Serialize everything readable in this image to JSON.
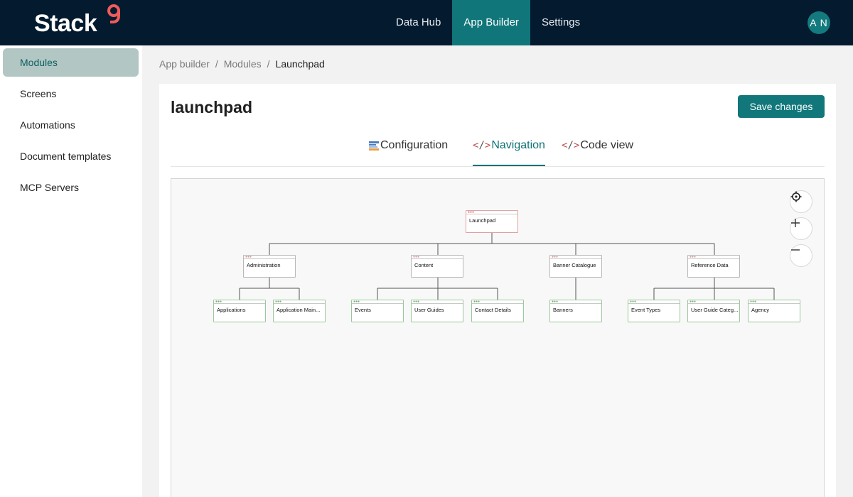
{
  "app": {
    "logo_text": "Stack",
    "logo_mark": "9",
    "avatar_initials": "A N"
  },
  "topnav": [
    {
      "label": "Data Hub"
    },
    {
      "label": "App Builder"
    },
    {
      "label": "Settings"
    }
  ],
  "sidebar": {
    "items": [
      {
        "label": "Modules"
      },
      {
        "label": "Screens"
      },
      {
        "label": "Automations"
      },
      {
        "label": "Document templates"
      },
      {
        "label": "MCP Servers"
      }
    ]
  },
  "breadcrumb": {
    "items": [
      "App builder",
      "Modules",
      "Launchpad"
    ],
    "separator": "/"
  },
  "page": {
    "title": "launchpad",
    "save_label": "Save changes"
  },
  "tabs": [
    {
      "label": "Configuration",
      "icon": "config-icon"
    },
    {
      "label": "Navigation",
      "icon": "code-icon"
    },
    {
      "label": "Code view",
      "icon": "code-icon"
    }
  ],
  "tree": {
    "root": {
      "label": "Launchpad"
    },
    "groups": [
      {
        "label": "Administration",
        "children": [
          "Applications",
          "Application Main..."
        ]
      },
      {
        "label": "Content",
        "children": [
          "Events",
          "User Guides",
          "Contact Details"
        ]
      },
      {
        "label": "Banner Catalogue",
        "children": [
          "Banners"
        ]
      },
      {
        "label": "Reference Data",
        "children": [
          "Event Types",
          "User Guide Categ...",
          "Agency"
        ]
      }
    ]
  },
  "colors": {
    "topbar": "#041a2e",
    "accent": "#11777b",
    "sidebar_active": "#b2c7c3",
    "root_node_border": "#e3a1a1",
    "leaf_node_border": "#9cc79c"
  }
}
